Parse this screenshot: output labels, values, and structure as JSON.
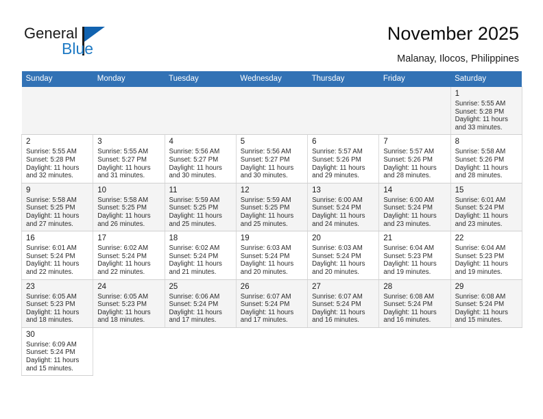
{
  "brand": {
    "name_top": "General",
    "name_bottom": "Blue",
    "accent_color": "#1f7ac4",
    "flag_color": "#1263b0"
  },
  "header": {
    "title": "November 2025",
    "subtitle": "Malanay, Ilocos, Philippines"
  },
  "calendar": {
    "header_bg": "#3272b5",
    "weekdays": [
      "Sunday",
      "Monday",
      "Tuesday",
      "Wednesday",
      "Thursday",
      "Friday",
      "Saturday"
    ],
    "labels": {
      "sunrise": "Sunrise:",
      "sunset": "Sunset:",
      "daylight": "Daylight:"
    },
    "weeks": [
      [
        {
          "empty": true
        },
        {
          "empty": true
        },
        {
          "empty": true
        },
        {
          "empty": true
        },
        {
          "empty": true
        },
        {
          "empty": true
        },
        {
          "day": "1",
          "sunrise": "Sunrise: 5:55 AM",
          "sunset": "Sunset: 5:28 PM",
          "daylight_1": "Daylight: 11 hours",
          "daylight_2": "and 33 minutes."
        }
      ],
      [
        {
          "day": "2",
          "sunrise": "Sunrise: 5:55 AM",
          "sunset": "Sunset: 5:28 PM",
          "daylight_1": "Daylight: 11 hours",
          "daylight_2": "and 32 minutes."
        },
        {
          "day": "3",
          "sunrise": "Sunrise: 5:55 AM",
          "sunset": "Sunset: 5:27 PM",
          "daylight_1": "Daylight: 11 hours",
          "daylight_2": "and 31 minutes."
        },
        {
          "day": "4",
          "sunrise": "Sunrise: 5:56 AM",
          "sunset": "Sunset: 5:27 PM",
          "daylight_1": "Daylight: 11 hours",
          "daylight_2": "and 30 minutes."
        },
        {
          "day": "5",
          "sunrise": "Sunrise: 5:56 AM",
          "sunset": "Sunset: 5:27 PM",
          "daylight_1": "Daylight: 11 hours",
          "daylight_2": "and 30 minutes."
        },
        {
          "day": "6",
          "sunrise": "Sunrise: 5:57 AM",
          "sunset": "Sunset: 5:26 PM",
          "daylight_1": "Daylight: 11 hours",
          "daylight_2": "and 29 minutes."
        },
        {
          "day": "7",
          "sunrise": "Sunrise: 5:57 AM",
          "sunset": "Sunset: 5:26 PM",
          "daylight_1": "Daylight: 11 hours",
          "daylight_2": "and 28 minutes."
        },
        {
          "day": "8",
          "sunrise": "Sunrise: 5:58 AM",
          "sunset": "Sunset: 5:26 PM",
          "daylight_1": "Daylight: 11 hours",
          "daylight_2": "and 28 minutes."
        }
      ],
      [
        {
          "day": "9",
          "sunrise": "Sunrise: 5:58 AM",
          "sunset": "Sunset: 5:25 PM",
          "daylight_1": "Daylight: 11 hours",
          "daylight_2": "and 27 minutes."
        },
        {
          "day": "10",
          "sunrise": "Sunrise: 5:58 AM",
          "sunset": "Sunset: 5:25 PM",
          "daylight_1": "Daylight: 11 hours",
          "daylight_2": "and 26 minutes."
        },
        {
          "day": "11",
          "sunrise": "Sunrise: 5:59 AM",
          "sunset": "Sunset: 5:25 PM",
          "daylight_1": "Daylight: 11 hours",
          "daylight_2": "and 25 minutes."
        },
        {
          "day": "12",
          "sunrise": "Sunrise: 5:59 AM",
          "sunset": "Sunset: 5:25 PM",
          "daylight_1": "Daylight: 11 hours",
          "daylight_2": "and 25 minutes."
        },
        {
          "day": "13",
          "sunrise": "Sunrise: 6:00 AM",
          "sunset": "Sunset: 5:24 PM",
          "daylight_1": "Daylight: 11 hours",
          "daylight_2": "and 24 minutes."
        },
        {
          "day": "14",
          "sunrise": "Sunrise: 6:00 AM",
          "sunset": "Sunset: 5:24 PM",
          "daylight_1": "Daylight: 11 hours",
          "daylight_2": "and 23 minutes."
        },
        {
          "day": "15",
          "sunrise": "Sunrise: 6:01 AM",
          "sunset": "Sunset: 5:24 PM",
          "daylight_1": "Daylight: 11 hours",
          "daylight_2": "and 23 minutes."
        }
      ],
      [
        {
          "day": "16",
          "sunrise": "Sunrise: 6:01 AM",
          "sunset": "Sunset: 5:24 PM",
          "daylight_1": "Daylight: 11 hours",
          "daylight_2": "and 22 minutes."
        },
        {
          "day": "17",
          "sunrise": "Sunrise: 6:02 AM",
          "sunset": "Sunset: 5:24 PM",
          "daylight_1": "Daylight: 11 hours",
          "daylight_2": "and 22 minutes."
        },
        {
          "day": "18",
          "sunrise": "Sunrise: 6:02 AM",
          "sunset": "Sunset: 5:24 PM",
          "daylight_1": "Daylight: 11 hours",
          "daylight_2": "and 21 minutes."
        },
        {
          "day": "19",
          "sunrise": "Sunrise: 6:03 AM",
          "sunset": "Sunset: 5:24 PM",
          "daylight_1": "Daylight: 11 hours",
          "daylight_2": "and 20 minutes."
        },
        {
          "day": "20",
          "sunrise": "Sunrise: 6:03 AM",
          "sunset": "Sunset: 5:24 PM",
          "daylight_1": "Daylight: 11 hours",
          "daylight_2": "and 20 minutes."
        },
        {
          "day": "21",
          "sunrise": "Sunrise: 6:04 AM",
          "sunset": "Sunset: 5:23 PM",
          "daylight_1": "Daylight: 11 hours",
          "daylight_2": "and 19 minutes."
        },
        {
          "day": "22",
          "sunrise": "Sunrise: 6:04 AM",
          "sunset": "Sunset: 5:23 PM",
          "daylight_1": "Daylight: 11 hours",
          "daylight_2": "and 19 minutes."
        }
      ],
      [
        {
          "day": "23",
          "sunrise": "Sunrise: 6:05 AM",
          "sunset": "Sunset: 5:23 PM",
          "daylight_1": "Daylight: 11 hours",
          "daylight_2": "and 18 minutes."
        },
        {
          "day": "24",
          "sunrise": "Sunrise: 6:05 AM",
          "sunset": "Sunset: 5:23 PM",
          "daylight_1": "Daylight: 11 hours",
          "daylight_2": "and 18 minutes."
        },
        {
          "day": "25",
          "sunrise": "Sunrise: 6:06 AM",
          "sunset": "Sunset: 5:24 PM",
          "daylight_1": "Daylight: 11 hours",
          "daylight_2": "and 17 minutes."
        },
        {
          "day": "26",
          "sunrise": "Sunrise: 6:07 AM",
          "sunset": "Sunset: 5:24 PM",
          "daylight_1": "Daylight: 11 hours",
          "daylight_2": "and 17 minutes."
        },
        {
          "day": "27",
          "sunrise": "Sunrise: 6:07 AM",
          "sunset": "Sunset: 5:24 PM",
          "daylight_1": "Daylight: 11 hours",
          "daylight_2": "and 16 minutes."
        },
        {
          "day": "28",
          "sunrise": "Sunrise: 6:08 AM",
          "sunset": "Sunset: 5:24 PM",
          "daylight_1": "Daylight: 11 hours",
          "daylight_2": "and 16 minutes."
        },
        {
          "day": "29",
          "sunrise": "Sunrise: 6:08 AM",
          "sunset": "Sunset: 5:24 PM",
          "daylight_1": "Daylight: 11 hours",
          "daylight_2": "and 15 minutes."
        }
      ],
      [
        {
          "day": "30",
          "sunrise": "Sunrise: 6:09 AM",
          "sunset": "Sunset: 5:24 PM",
          "daylight_1": "Daylight: 11 hours",
          "daylight_2": "and 15 minutes."
        },
        {
          "blank": true
        },
        {
          "blank": true
        },
        {
          "blank": true
        },
        {
          "blank": true
        },
        {
          "blank": true
        },
        {
          "blank": true
        }
      ]
    ]
  }
}
